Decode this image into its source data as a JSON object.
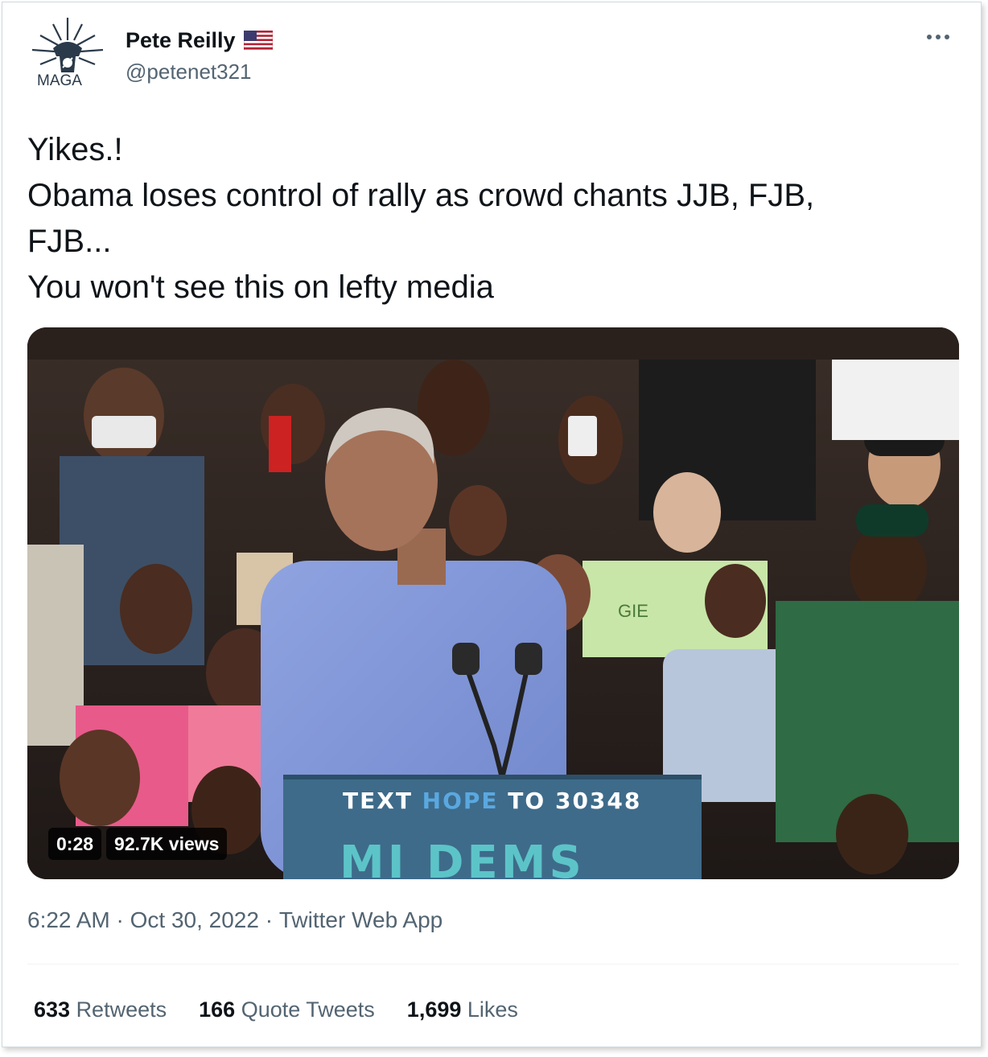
{
  "tweet": {
    "author": {
      "display_name": "Pete Reilly",
      "handle": "@petenet321",
      "avatar_text": "MAGA",
      "flag_icon": "us-flag-icon"
    },
    "more_icon": "more-options-icon",
    "text_lines": [
      "Yikes.!",
      "Obama loses control of rally as crowd chants JJB, FJB,",
      "FJB...",
      "You won't see this on lefty media"
    ],
    "media": {
      "type": "video",
      "duration": "0:28",
      "views": "92.7K views",
      "podium_line1_a": "TEXT ",
      "podium_line1_b": "HOPE",
      "podium_line1_c": " TO 30348",
      "podium_line2": "MI DEMS",
      "sign_text": "GIE"
    },
    "time": "6:22 AM",
    "separator": " · ",
    "date": "Oct 30, 2022",
    "source": "Twitter Web App",
    "stats": [
      {
        "count": "633",
        "label": "Retweets"
      },
      {
        "count": "166",
        "label": "Quote Tweets"
      },
      {
        "count": "1,699",
        "label": "Likes"
      }
    ],
    "colors": {
      "text": "#0f1419",
      "secondary": "#536471",
      "border": "#cfd9de"
    }
  }
}
